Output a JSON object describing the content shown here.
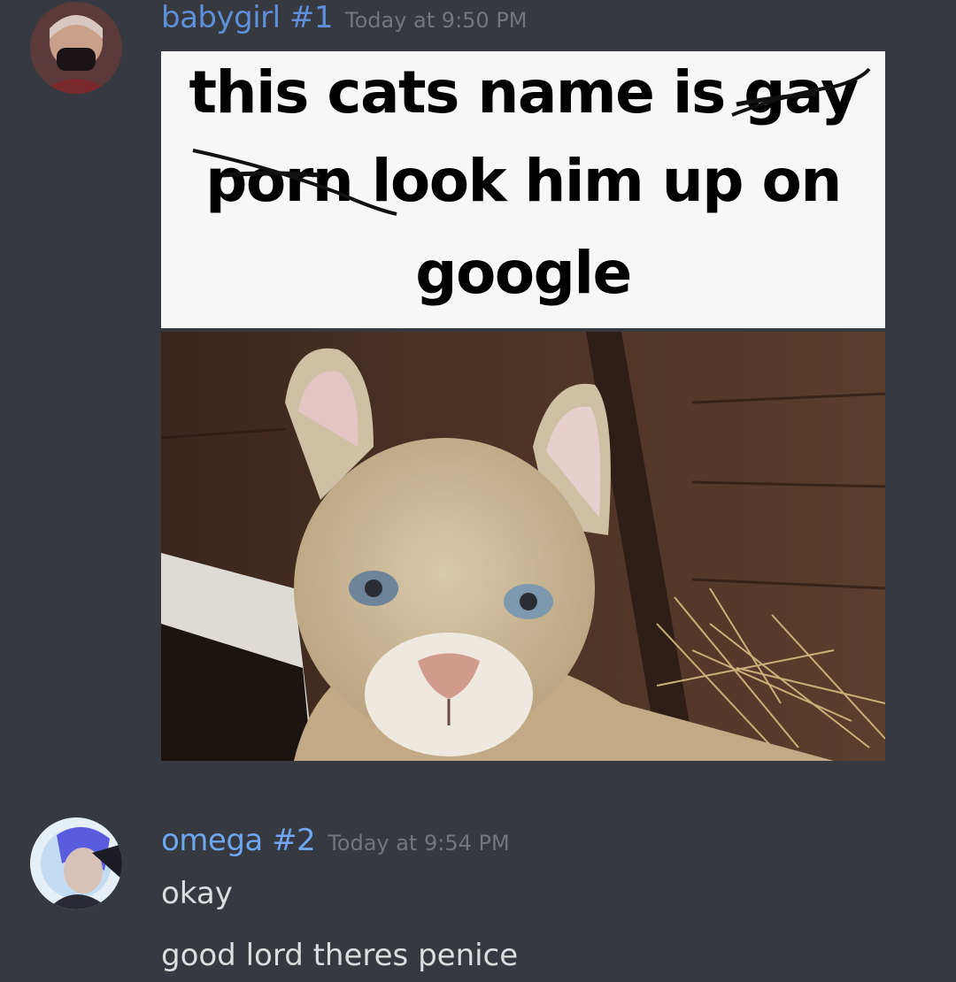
{
  "messages": [
    {
      "username": "babygirl #1",
      "username_color": "#5e8fd8",
      "timestamp": "Today at 9:50 PM",
      "meme": {
        "line1": "this cats name is gay",
        "line2": "porn look him up on",
        "line3": "google"
      }
    },
    {
      "username": "omega #2",
      "username_color": "#6fa5ef",
      "timestamp": "Today at 9:54 PM",
      "lines": [
        "okay",
        "good lord theres penice"
      ]
    }
  ],
  "icons": {
    "avatar1": "masked-person-avatar",
    "avatar2": "anime-character-avatar"
  }
}
